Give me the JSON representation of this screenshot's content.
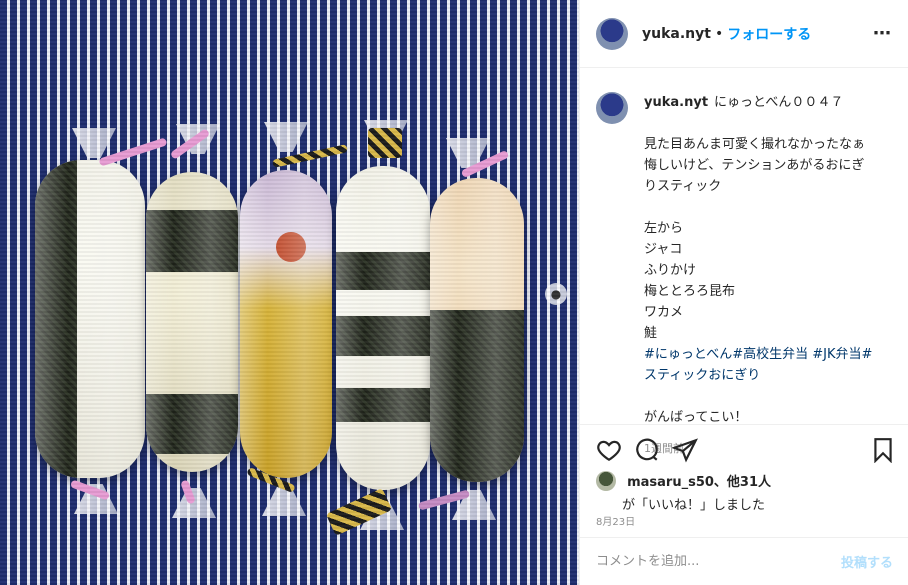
{
  "post": {
    "username": "yuka.nyt",
    "dot": "•",
    "follow_label": "フォローする",
    "more_icon": "⋯"
  },
  "caption": {
    "username": "yuka.nyt",
    "first_line": "にゅっとべん００４７",
    "body": "見た目あんま可愛く撮れなかったなぁ\n悔しいけど、テンションあがるおにぎ\nりスティック\n\n左から\nジャコ\nふりかけ\n梅ととろろ昆布\nワカメ\n鮭\n",
    "hashtags_line1": "#にゅっとべん#高校生弁当 #JK弁当#",
    "hashtags_line2": "スティックおにぎり",
    "closing": "がんばってこい！",
    "time_ago": "1週間前"
  },
  "actions": {
    "icons": [
      "heart-icon",
      "comment-icon",
      "share-icon",
      "bookmark-icon"
    ]
  },
  "likes": {
    "liker": "masaru_s50、他31人",
    "suffix": "が「いいね！」しました",
    "date": "8月23日"
  },
  "comment": {
    "placeholder": "コメントを追加...",
    "post_label": "投稿する"
  }
}
